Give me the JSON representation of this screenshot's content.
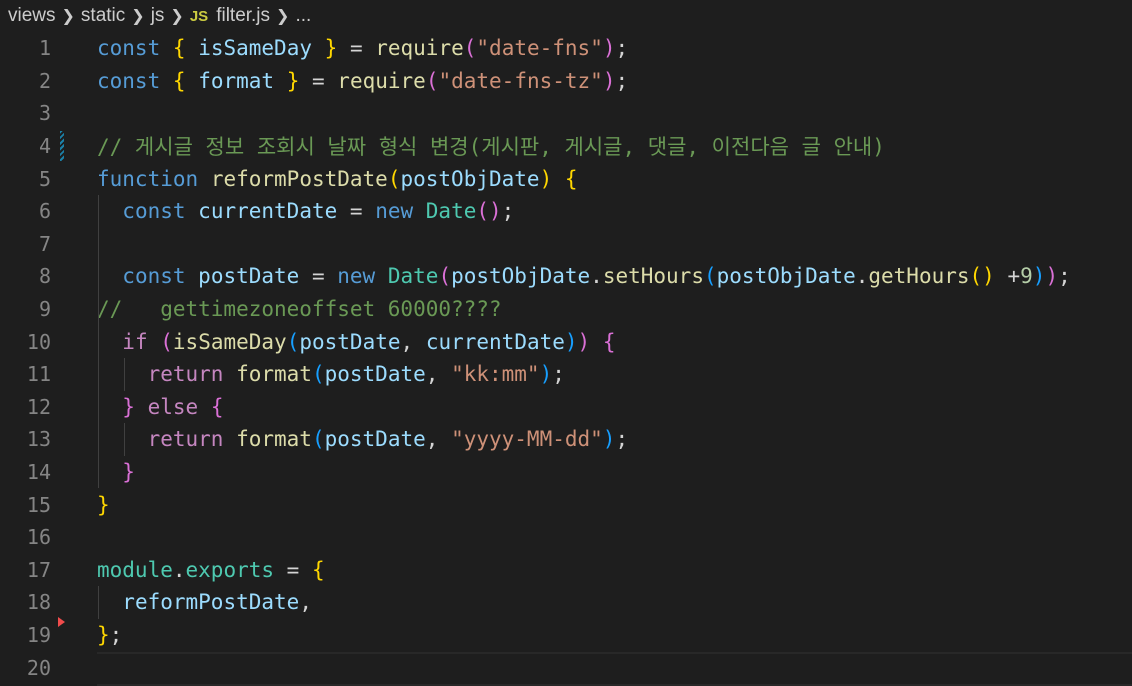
{
  "breadcrumb": {
    "items": [
      "views",
      "static",
      "js"
    ],
    "file_badge": "JS",
    "file_name": "filter.js",
    "trailing": "..."
  },
  "lines": [
    {
      "n": "1",
      "tokens": [
        [
          "kw",
          "const"
        ],
        [
          "plain",
          " "
        ],
        [
          "b1",
          "{"
        ],
        [
          "plain",
          " "
        ],
        [
          "var",
          "isSameDay"
        ],
        [
          "plain",
          " "
        ],
        [
          "b1",
          "}"
        ],
        [
          "plain",
          " = "
        ],
        [
          "fn",
          "require"
        ],
        [
          "b2",
          "("
        ],
        [
          "str",
          "\"date-fns\""
        ],
        [
          "b2",
          ")"
        ],
        [
          "plain",
          ";"
        ]
      ]
    },
    {
      "n": "2",
      "tokens": [
        [
          "kw",
          "const"
        ],
        [
          "plain",
          " "
        ],
        [
          "b1",
          "{"
        ],
        [
          "plain",
          " "
        ],
        [
          "var",
          "format"
        ],
        [
          "plain",
          " "
        ],
        [
          "b1",
          "}"
        ],
        [
          "plain",
          " = "
        ],
        [
          "fn",
          "require"
        ],
        [
          "b2",
          "("
        ],
        [
          "str",
          "\"date-fns-tz\""
        ],
        [
          "b2",
          ")"
        ],
        [
          "plain",
          ";"
        ]
      ]
    },
    {
      "n": "3",
      "tokens": []
    },
    {
      "n": "4",
      "tokens": [
        [
          "cmt",
          "// 게시글 정보 조회시 날짜 형식 변경(게시판, 게시글, 댓글, 이전다음 글 안내)"
        ]
      ]
    },
    {
      "n": "5",
      "tokens": [
        [
          "kw",
          "function"
        ],
        [
          "plain",
          " "
        ],
        [
          "fn",
          "reformPostDate"
        ],
        [
          "b1",
          "("
        ],
        [
          "var",
          "postObjDate"
        ],
        [
          "b1",
          ")"
        ],
        [
          "plain",
          " "
        ],
        [
          "b1",
          "{"
        ]
      ]
    },
    {
      "n": "6",
      "tokens": [
        [
          "plain",
          "  "
        ],
        [
          "kw",
          "const"
        ],
        [
          "plain",
          " "
        ],
        [
          "var",
          "currentDate"
        ],
        [
          "plain",
          " = "
        ],
        [
          "kw",
          "new"
        ],
        [
          "plain",
          " "
        ],
        [
          "cls",
          "Date"
        ],
        [
          "b2",
          "()"
        ],
        [
          "plain",
          ";"
        ]
      ]
    },
    {
      "n": "7",
      "tokens": []
    },
    {
      "n": "8",
      "tokens": [
        [
          "plain",
          "  "
        ],
        [
          "kw",
          "const"
        ],
        [
          "plain",
          " "
        ],
        [
          "var",
          "postDate"
        ],
        [
          "plain",
          " = "
        ],
        [
          "kw",
          "new"
        ],
        [
          "plain",
          " "
        ],
        [
          "cls",
          "Date"
        ],
        [
          "b2",
          "("
        ],
        [
          "var",
          "postObjDate"
        ],
        [
          "plain",
          "."
        ],
        [
          "fn",
          "setHours"
        ],
        [
          "b3",
          "("
        ],
        [
          "var",
          "postObjDate"
        ],
        [
          "plain",
          "."
        ],
        [
          "fn",
          "getHours"
        ],
        [
          "b1",
          "()"
        ],
        [
          "plain",
          " +"
        ],
        [
          "num",
          "9"
        ],
        [
          "b3",
          ")"
        ],
        [
          "b2",
          ")"
        ],
        [
          "plain",
          ";"
        ]
      ]
    },
    {
      "n": "9",
      "tokens": [
        [
          "cmt",
          "//   gettimezoneoffset 60000????"
        ]
      ]
    },
    {
      "n": "10",
      "tokens": [
        [
          "plain",
          "  "
        ],
        [
          "ctrl",
          "if"
        ],
        [
          "plain",
          " "
        ],
        [
          "b2",
          "("
        ],
        [
          "fn",
          "isSameDay"
        ],
        [
          "b3",
          "("
        ],
        [
          "var",
          "postDate"
        ],
        [
          "plain",
          ", "
        ],
        [
          "var",
          "currentDate"
        ],
        [
          "b3",
          ")"
        ],
        [
          "b2",
          ")"
        ],
        [
          "plain",
          " "
        ],
        [
          "b2",
          "{"
        ]
      ]
    },
    {
      "n": "11",
      "tokens": [
        [
          "plain",
          "    "
        ],
        [
          "ctrl",
          "return"
        ],
        [
          "plain",
          " "
        ],
        [
          "fn",
          "format"
        ],
        [
          "b3",
          "("
        ],
        [
          "var",
          "postDate"
        ],
        [
          "plain",
          ", "
        ],
        [
          "str",
          "\"kk:mm\""
        ],
        [
          "b3",
          ")"
        ],
        [
          "plain",
          ";"
        ]
      ]
    },
    {
      "n": "12",
      "tokens": [
        [
          "plain",
          "  "
        ],
        [
          "b2",
          "}"
        ],
        [
          "plain",
          " "
        ],
        [
          "ctrl",
          "else"
        ],
        [
          "plain",
          " "
        ],
        [
          "b2",
          "{"
        ]
      ]
    },
    {
      "n": "13",
      "tokens": [
        [
          "plain",
          "    "
        ],
        [
          "ctrl",
          "return"
        ],
        [
          "plain",
          " "
        ],
        [
          "fn",
          "format"
        ],
        [
          "b3",
          "("
        ],
        [
          "var",
          "postDate"
        ],
        [
          "plain",
          ", "
        ],
        [
          "str",
          "\"yyyy-MM-dd\""
        ],
        [
          "b3",
          ")"
        ],
        [
          "plain",
          ";"
        ]
      ]
    },
    {
      "n": "14",
      "tokens": [
        [
          "plain",
          "  "
        ],
        [
          "b2",
          "}"
        ]
      ]
    },
    {
      "n": "15",
      "tokens": [
        [
          "b1",
          "}"
        ]
      ]
    },
    {
      "n": "16",
      "tokens": []
    },
    {
      "n": "17",
      "tokens": [
        [
          "cls",
          "module"
        ],
        [
          "plain",
          "."
        ],
        [
          "cls",
          "exports"
        ],
        [
          "plain",
          " = "
        ],
        [
          "b1",
          "{"
        ]
      ]
    },
    {
      "n": "18",
      "tokens": [
        [
          "plain",
          "  "
        ],
        [
          "var",
          "reformPostDate"
        ],
        [
          "plain",
          ","
        ]
      ]
    },
    {
      "n": "19",
      "tokens": [
        [
          "b1",
          "}"
        ],
        [
          "plain",
          ";"
        ]
      ]
    },
    {
      "n": "20",
      "tokens": []
    }
  ],
  "colors": {
    "background": "#1e1e1e",
    "keyword": "#569cd6",
    "control": "#c586c0",
    "variable": "#9cdcfe",
    "function": "#dcdcaa",
    "string": "#ce9178",
    "comment": "#6a9955"
  }
}
